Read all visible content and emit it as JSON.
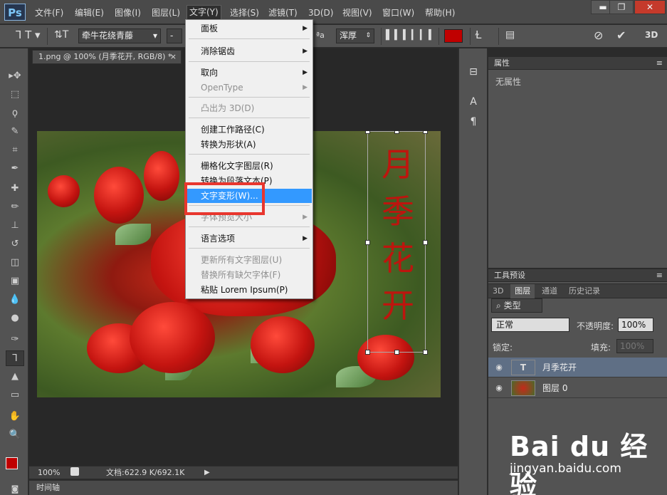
{
  "app": {
    "logo": "Ps"
  },
  "menubar": {
    "items": [
      "文件(F)",
      "编辑(E)",
      "图像(I)",
      "图层(L)",
      "文字(Y)",
      "选择(S)",
      "滤镜(T)",
      "3D(D)",
      "视图(V)",
      "窗口(W)",
      "帮助(H)"
    ],
    "active_index": 4
  },
  "window_controls": {
    "minimize": "▬",
    "restore": "❐",
    "close": "✕"
  },
  "options": {
    "font_family": "牵牛花绕青藤",
    "font_style": "-",
    "antialias": "浑厚",
    "text_color": "#c00000",
    "threed_label": "3D"
  },
  "document": {
    "tab_title": "1.png @ 100% (月季花开, RGB/8) *",
    "tab_close": "×",
    "vertical_text": [
      "月",
      "季",
      "花",
      "开"
    ],
    "zoom": "100%",
    "doc_info": "文档:622.9 K/692.1K",
    "timeline": "时间轴"
  },
  "text_menu": {
    "items": [
      {
        "label": "面板",
        "submenu": true,
        "disabled": false
      },
      {
        "label": "消除锯齿",
        "submenu": true,
        "disabled": false
      },
      {
        "label": "取向",
        "submenu": true,
        "disabled": false
      },
      {
        "label": "OpenType",
        "submenu": true,
        "disabled": true
      },
      {
        "label": "凸出为 3D(D)",
        "submenu": false,
        "disabled": true
      },
      {
        "label": "创建工作路径(C)",
        "submenu": false,
        "disabled": false
      },
      {
        "label": "转换为形状(A)",
        "submenu": false,
        "disabled": false
      },
      {
        "label": "栅格化文字图层(R)",
        "submenu": false,
        "disabled": false
      },
      {
        "label": "转换为段落文本(P)",
        "submenu": false,
        "disabled": false
      },
      {
        "label": "文字变形(W)...",
        "submenu": false,
        "disabled": false,
        "highlighted": true
      },
      {
        "label": "字体预览大小",
        "submenu": true,
        "disabled": true
      },
      {
        "label": "语言选项",
        "submenu": true,
        "disabled": false
      },
      {
        "label": "更新所有文字图层(U)",
        "submenu": false,
        "disabled": true
      },
      {
        "label": "替换所有缺欠字体(F)",
        "submenu": false,
        "disabled": true
      },
      {
        "label": "粘贴 Lorem Ipsum(P)",
        "submenu": false,
        "disabled": false
      }
    ]
  },
  "properties_panel": {
    "title": "属性",
    "empty_text": "无属性"
  },
  "tool_presets_panel": {
    "title": "工具预设"
  },
  "layers_panel": {
    "tabs": [
      "3D",
      "图层",
      "通道",
      "历史记录"
    ],
    "active_tab": 1,
    "filter_label": "类型",
    "blend_mode": "正常",
    "opacity_label": "不透明度:",
    "opacity_value": "100%",
    "lock_label": "锁定:",
    "fill_label": "填充:",
    "fill_value": "100%",
    "layers": [
      {
        "name": "月季花开",
        "type": "text",
        "selected": true
      },
      {
        "name": "图层 0",
        "type": "image",
        "selected": false
      }
    ]
  },
  "watermark": {
    "logo": "Bai du 经验",
    "url": "jingyan.baidu.com"
  }
}
